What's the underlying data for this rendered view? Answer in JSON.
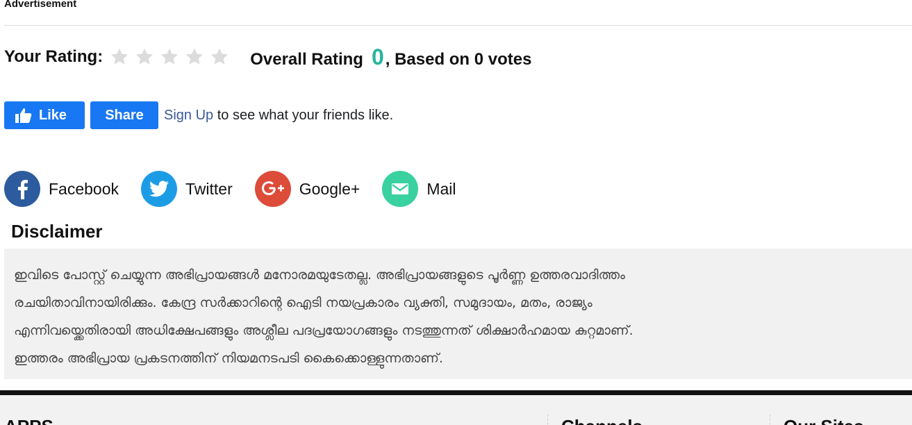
{
  "ad": {
    "label": "Advertisement"
  },
  "rating": {
    "your_rating_label": "Your Rating:",
    "stars": 5,
    "star_color": "#dcdcdc",
    "overall_prefix": "Overall Rating",
    "overall_value": "0",
    "overall_value_color": "#2ab39c",
    "overall_suffix": ", Based on 0 votes"
  },
  "facebook_widget": {
    "like_label": "Like",
    "share_label": "Share",
    "signup_link": "Sign Up",
    "signup_text": " to see what your friends like.",
    "button_color": "#1877f2"
  },
  "share": [
    {
      "name": "Facebook",
      "icon": "facebook-icon",
      "color": "#2d5c9e"
    },
    {
      "name": "Twitter",
      "icon": "twitter-icon",
      "color": "#1d9ce6"
    },
    {
      "name": "Google+",
      "icon": "google-plus-icon",
      "color": "#dd4b39"
    },
    {
      "name": "Mail",
      "icon": "mail-icon",
      "color": "#39d1a0"
    }
  ],
  "disclaimer": {
    "title": "Disclaimer",
    "lines": [
      "ഇവിടെ പോസ്റ്റ് ചെയ്യുന്ന അഭിപ്രായങ്ങൾ മനോരമയുടേതല്ല. അഭിപ്രായങ്ങളുടെ പൂർണ്ണ ഉത്തരവാദിത്തം",
      "രചയിതാവിനായിരിക്കും. കേന്ദ്ര സർക്കാറിന്റെ ഐടി നയപ്രകാരം വ്യക്തി, സമുദായം, മതം, രാജ്യം",
      "എന്നിവയ്ക്കെതിരായി അധിക്ഷേപങ്ങളും അശ്ലീല പദപ്രയോഗങ്ങളും നടത്തുന്നത് ശിക്ഷാർഹമായ കുറ്റമാണ്.",
      "ഇത്തരം അഭിപ്രായ പ്രകടനത്തിന് നിയമനടപടി കൈക്കൊള്ളുന്നതാണ്."
    ]
  },
  "footer": {
    "columns": [
      "APPS",
      "Channels",
      "Our Sites"
    ]
  }
}
